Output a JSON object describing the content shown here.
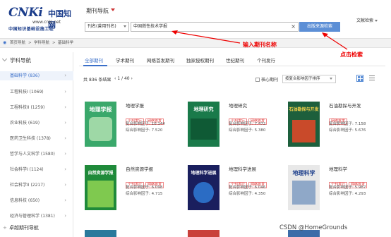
{
  "header": {
    "logo_latin": "CNKi",
    "logo_cn": "中国知网",
    "logo_url": "www.cnki.net",
    "logo_sub": "中国知识基础设施工程",
    "nav_title": "期刊导航",
    "search_type": "刊名(曾用刊名)",
    "search_value": "中国燃性技术学报",
    "search_button": "出版来源检索",
    "pub_search": "文献检索"
  },
  "breadcrumb": {
    "items": [
      "首页导航",
      ">",
      "学科导航",
      ">",
      "基础科学"
    ]
  },
  "sidebar": {
    "heading": "学科导航",
    "items": [
      {
        "label": "基础科学 (836)"
      },
      {
        "label": "工程科技I (1069)"
      },
      {
        "label": "工程科技II (1259)"
      },
      {
        "label": "农业科技 (619)"
      },
      {
        "label": "医药卫生科技 (1378)"
      },
      {
        "label": "哲学与人文科学 (1580)"
      },
      {
        "label": "社会科学I (1124)"
      },
      {
        "label": "社会科学II (2217)"
      },
      {
        "label": "信息科技 (650)"
      },
      {
        "label": "经济与管理科学 (1381)"
      }
    ],
    "footer": "卓越期刊导航",
    "chevron": "›"
  },
  "tabs": [
    "全部期刊",
    "学术期刊",
    "网络首发期刊",
    "独家授权期刊",
    "世纪期刊",
    "个刊发行"
  ],
  "toolbar": {
    "count_prefix": "共",
    "count": "836",
    "count_suffix": "条结果",
    "pager": "‹  1 / 40  ›",
    "core_label": "核心期刊",
    "sort_label": "按复合影响因子排序"
  },
  "cards": [
    {
      "name": "地理学报",
      "cover_title": "地理学报",
      "cover_bg": "#3aa86b",
      "cover_fg": "#fff",
      "tags": [
        "个刊发行",
        "网络首发"
      ],
      "m1": "复合影响因子: 10.144",
      "m2": "综合影响因子: 7.520"
    },
    {
      "name": "地理研究",
      "cover_title": "地理研究",
      "cover_bg": "#1a7a4a",
      "cover_fg": "#fff",
      "tags": [
        "个刊发行",
        "网络首发"
      ],
      "m1": "复合影响因子: 7.472",
      "m2": "综合影响因子: 5.380"
    },
    {
      "name": "石油勘探与开发",
      "cover_title": "石油勘探与开发",
      "cover_bg": "#1d5f3c",
      "cover_fg": "#f6d34a",
      "tags": [
        "网络首发"
      ],
      "m1": "复合影响因子: 7.158",
      "m2": "综合影响因子: 5.676"
    },
    {
      "name": "自然资源学报",
      "cover_title": "自然资源学报",
      "cover_bg": "#1f8a3a",
      "cover_fg": "#fff",
      "tags": [
        "个刊发行",
        "网络首发"
      ],
      "m1": "复合影响因子: 6.098",
      "m2": "综合影响因子: 4.715"
    },
    {
      "name": "地理科学进展",
      "cover_title": "地理科学进展",
      "cover_bg": "#1a1f5e",
      "cover_fg": "#fff",
      "tags": [
        "个刊发行",
        "网络首发"
      ],
      "m1": "复合影响因子: 6.046",
      "m2": "综合影响因子: 4.350"
    },
    {
      "name": "地理科学",
      "cover_title": "地理科学",
      "cover_bg": "#e8e8e8",
      "cover_fg": "#1a3c8a",
      "tags": [
        "个刊发行",
        "网络首发"
      ],
      "m1": "复合影响因子: 5.987",
      "m2": "综合影响因子: 4.293"
    }
  ],
  "annotations": {
    "input_hint": "输入期刊名称",
    "search_hint": "点击检索"
  },
  "watermark": "CSDN @HomeGrounds",
  "colors": {
    "accent": "#3a6fc9",
    "annotation": "#e00000",
    "search_button": "#5c8fd6"
  }
}
